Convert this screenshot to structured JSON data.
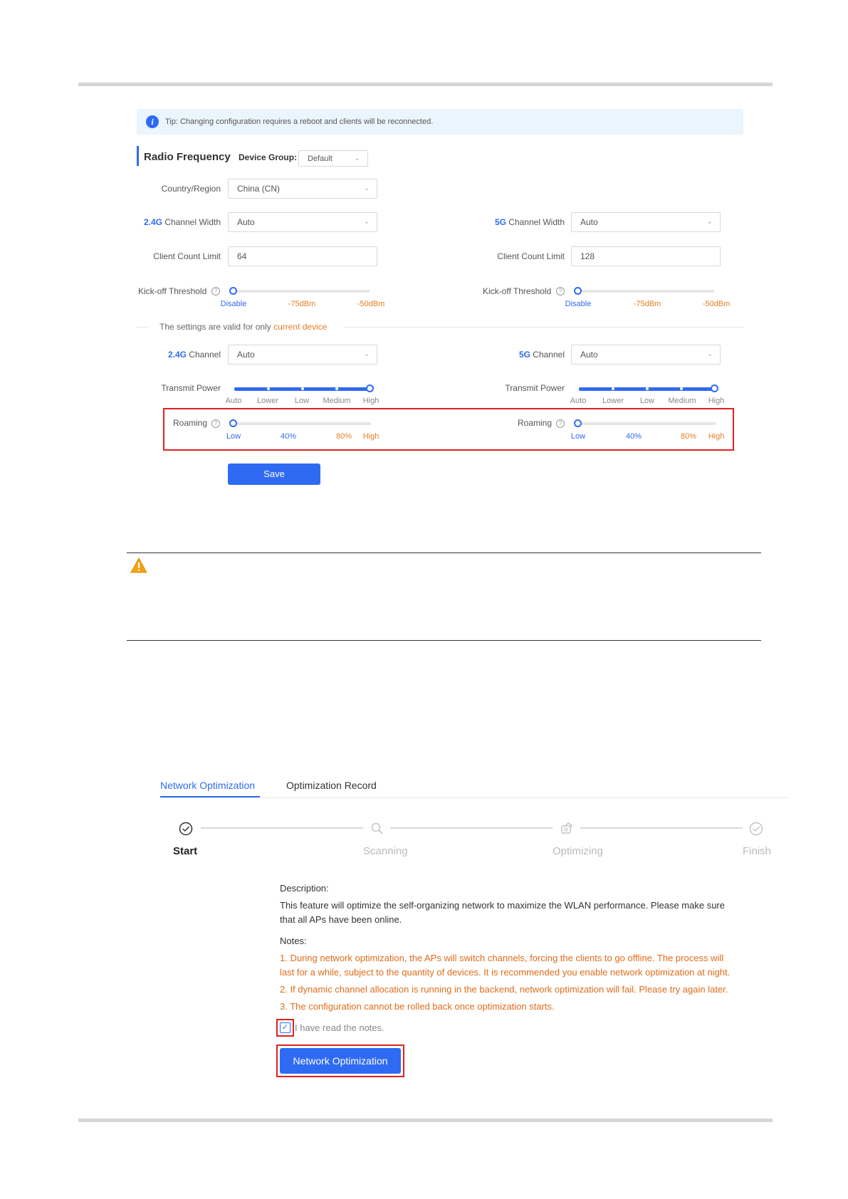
{
  "tip": {
    "icon": "info-icon",
    "text": "Tip: Changing configuration requires a reboot and clients will be reconnected."
  },
  "radio": {
    "title": "Radio Frequency",
    "device_group_label": "Device Group:",
    "device_group_value": "Default",
    "country_label": "Country/Region",
    "country_value": "China (CN)",
    "ch24_width_prefix": "2.4G",
    "ch24_width_label": " Channel Width",
    "ch24_width_value": "Auto",
    "ch5_width_prefix": "5G",
    "ch5_width_label": " Channel Width",
    "ch5_width_value": "Auto",
    "client_limit_label": "Client Count Limit",
    "client_limit_24": "64",
    "client_limit_5": "128",
    "kickoff_label": "Kick-off Threshold",
    "kickoff_ticks": [
      "Disable",
      "-75dBm",
      "-50dBm"
    ],
    "separator_prefix": "The settings are valid for only ",
    "separator_highlight": "current device",
    "ch24_prefix": "2.4G",
    "ch24_label": " Channel",
    "ch24_value": "Auto",
    "ch5_prefix": "5G",
    "ch5_label": " Channel",
    "ch5_value": "Auto",
    "tx_label": "Transmit Power",
    "tx_ticks": [
      "Auto",
      "Lower",
      "Low",
      "Medium",
      "High"
    ],
    "tx_level": "High",
    "roaming_label": "Roaming",
    "roaming_ticks": [
      "Low",
      "40%",
      "80%",
      "High"
    ],
    "roaming_level": "Low",
    "kickoff_level": "Disable",
    "save_label": "Save"
  },
  "warning": {
    "icon": "warning-icon"
  },
  "optimization": {
    "tabs": [
      "Network Optimization",
      "Optimization Record"
    ],
    "steps": [
      "Start",
      "Scanning",
      "Optimizing",
      "Finish"
    ],
    "description_title": "Description:",
    "description_line1": "This feature will optimize the self-organizing network to maximize the WLAN performance. Please make sure",
    "description_line2": "that all APs have been online.",
    "notes_title": "Notes:",
    "note1_line1": "1. During network optimization, the APs will switch channels, forcing the clients to go offline. The process will",
    "note1_line2": "last for a while, subject to the quantity of devices. It is recommended you enable network optimization at night.",
    "note2": "2. If dynamic channel allocation is running in the backend, network optimization will fail. Please try again later.",
    "note3": "3. The configuration cannot be rolled back once optimization starts.",
    "checkbox_label": "I have read the notes.",
    "checkbox_checked": true,
    "button_label": "Network Optimization",
    "colors": {
      "accent": "#2f6bf2",
      "warning_text": "#e06c1a",
      "highlight_box": "#e02020"
    }
  }
}
